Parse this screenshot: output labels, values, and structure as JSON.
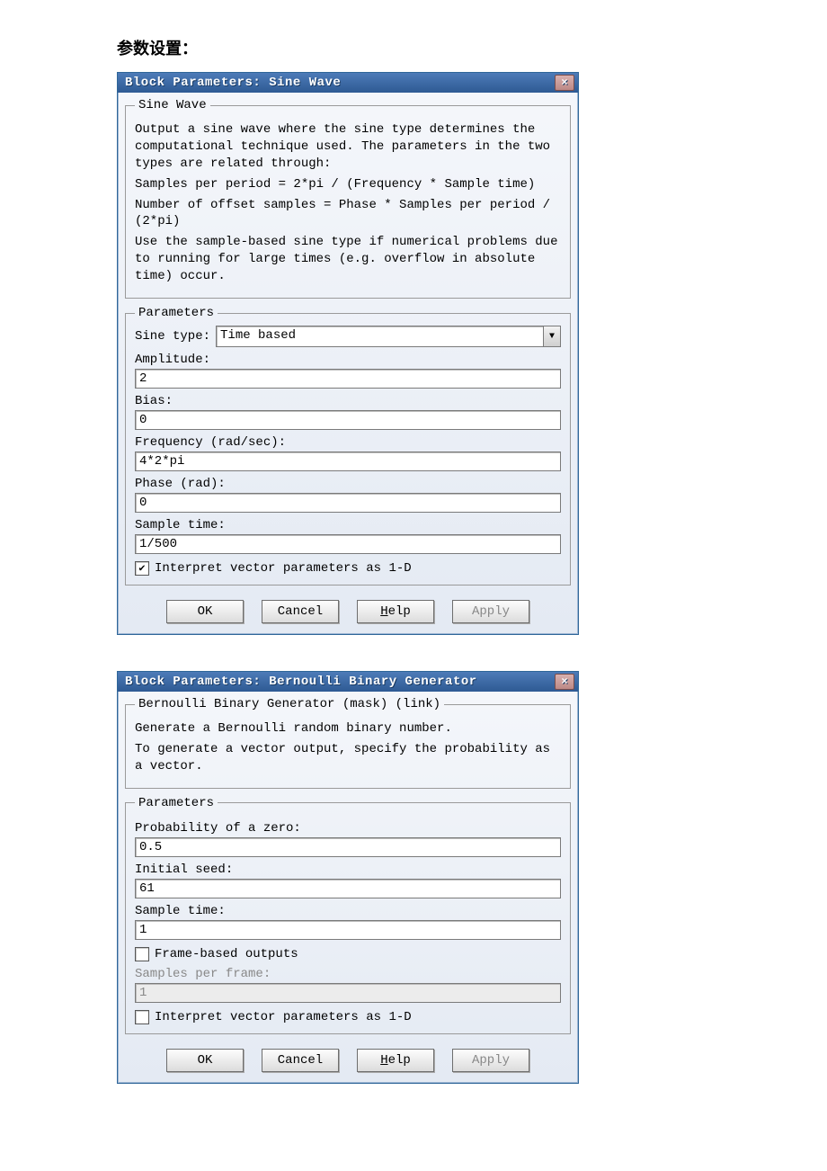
{
  "page": {
    "heading": "参数设置："
  },
  "dlg1": {
    "title": "Block Parameters: Sine Wave",
    "close": "×",
    "fs_top_legend": "Sine Wave",
    "p1": "Output a sine wave where the sine type determines the computational technique used. The parameters in the two types are related through:",
    "p2": "Samples per period = 2*pi / (Frequency * Sample time)",
    "p3": "Number of offset samples = Phase * Samples per period / (2*pi)",
    "p4": "Use the sample-based sine type if numerical problems due to running for large times (e.g. overflow in absolute time) occur.",
    "fs_params_legend": "Parameters",
    "sine_type_label": "Sine type:",
    "sine_type_value": "Time based",
    "amp_label": "Amplitude:",
    "amp_value": "2",
    "bias_label": "Bias:",
    "bias_value": "0",
    "freq_label": "Frequency (rad/sec):",
    "freq_value": "4*2*pi",
    "phase_label": "Phase (rad):",
    "phase_value": "0",
    "st_label": "Sample time:",
    "st_value": "1/500",
    "chk_label": "Interpret vector parameters as 1-D",
    "chk_checked": true,
    "buttons": {
      "ok": "OK",
      "cancel": "Cancel",
      "help_pre": "H",
      "help_rest": "elp",
      "apply": "Apply"
    }
  },
  "dlg2": {
    "title": "Block Parameters: Bernoulli Binary Generator",
    "close": "×",
    "fs_top_legend": "Bernoulli Binary Generator (mask) (link)",
    "p1": "Generate a Bernoulli random binary number.",
    "p2": "To generate a vector output, specify the probability as a vector.",
    "fs_params_legend": "Parameters",
    "prob_label": "Probability of a zero:",
    "prob_value": "0.5",
    "seed_label": "Initial seed:",
    "seed_value": "61",
    "st_label": "Sample time:",
    "st_value": "1",
    "chk_frame_label": "Frame-based outputs",
    "chk_frame_checked": false,
    "spf_label": "Samples per frame:",
    "spf_value": "1",
    "chk_vec_label": "Interpret vector parameters as 1-D",
    "chk_vec_checked": false,
    "buttons": {
      "ok": "OK",
      "cancel": "Cancel",
      "help_pre": "H",
      "help_rest": "elp",
      "apply": "Apply"
    }
  }
}
